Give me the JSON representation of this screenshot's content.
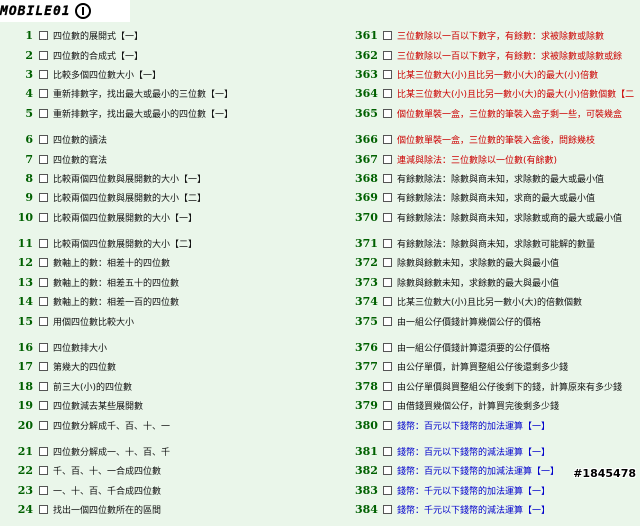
{
  "logo": {
    "text": "MOBILE01"
  },
  "left_groups": [
    [
      {
        "num": "1",
        "label": "四位數的展開式【一】",
        "color": "black"
      },
      {
        "num": "2",
        "label": "四位數的合成式【一】",
        "color": "black"
      },
      {
        "num": "3",
        "label": "比較多個四位數大小【一】",
        "color": "black"
      },
      {
        "num": "4",
        "label": "重新排數字，找出最大或最小的三位數【一】",
        "color": "black"
      },
      {
        "num": "5",
        "label": "重新排數字，找出最大或最小的四位數【一】",
        "color": "black"
      }
    ],
    [
      {
        "num": "6",
        "label": "四位數的讀法",
        "color": "black"
      },
      {
        "num": "7",
        "label": "四位數的寫法",
        "color": "black"
      },
      {
        "num": "8",
        "label": "比較兩個四位數與展開數的大小【一】",
        "color": "black"
      },
      {
        "num": "9",
        "label": "比較兩個四位數與展開數的大小【二】",
        "color": "black"
      },
      {
        "num": "10",
        "label": "比較兩個四位數展開數的大小【一】",
        "color": "black"
      }
    ],
    [
      {
        "num": "11",
        "label": "比較兩個四位數展開數的大小【二】",
        "color": "black"
      },
      {
        "num": "12",
        "label": "數軸上的數：相差十的四位數",
        "color": "black"
      },
      {
        "num": "13",
        "label": "數軸上的數：相差五十的四位數",
        "color": "black"
      },
      {
        "num": "14",
        "label": "數軸上的數：相差一百的四位數",
        "color": "black"
      },
      {
        "num": "15",
        "label": "用個四位數比較大小",
        "color": "black"
      }
    ],
    [
      {
        "num": "16",
        "label": "四位數排大小",
        "color": "black"
      },
      {
        "num": "17",
        "label": "第幾大的四位數",
        "color": "black"
      },
      {
        "num": "18",
        "label": "前三大(小)的四位數",
        "color": "black"
      },
      {
        "num": "19",
        "label": "四位數減去某些展開數",
        "color": "black"
      },
      {
        "num": "20",
        "label": "四位數分解成千、百、十、一",
        "color": "black"
      }
    ],
    [
      {
        "num": "21",
        "label": "四位數分解成一、十、百、千",
        "color": "black"
      },
      {
        "num": "22",
        "label": "千、百、十、一合成四位數",
        "color": "black"
      },
      {
        "num": "23",
        "label": "一、十、百、千合成四位數",
        "color": "black"
      },
      {
        "num": "24",
        "label": "找出一個四位數所在的區間",
        "color": "black"
      }
    ]
  ],
  "right_groups": [
    [
      {
        "num": "361",
        "label": "三位數除以一百以下數字，有餘數：求被除數或除數",
        "color": "red"
      },
      {
        "num": "362",
        "label": "三位數除以一百以下數字，有餘數：求被除數或除數或餘",
        "color": "red"
      },
      {
        "num": "363",
        "label": "比某三位數大(小)且比另一數小(大)的最大(小)倍數",
        "color": "red"
      },
      {
        "num": "364",
        "label": "比某三位數大(小)且比另一數小(大)的最大(小)倍數個數【二",
        "color": "red"
      },
      {
        "num": "365",
        "label": "個位數單裝一盒，三位數的筆裝入盒子剩一些，可裝幾盒",
        "color": "red"
      }
    ],
    [
      {
        "num": "366",
        "label": "個位數單裝一盒，三位數的筆裝入盒後，問餘幾枝",
        "color": "red"
      },
      {
        "num": "367",
        "label": "連減與除法：三位數除以一位數(有餘數)",
        "color": "red"
      },
      {
        "num": "368",
        "label": "有餘數除法：除數與商未知，求除數的最大或最小值",
        "color": "black"
      },
      {
        "num": "369",
        "label": "有餘數除法：除數與商未知，求商的最大或最小值",
        "color": "black"
      },
      {
        "num": "370",
        "label": "有餘數除法：除數與商未知，求除數或商的最大或最小值",
        "color": "black"
      }
    ],
    [
      {
        "num": "371",
        "label": "有餘數除法：除數與商未知，求除數可能解的數量",
        "color": "black"
      },
      {
        "num": "372",
        "label": "除數與餘數未知，求除數的最大與最小值",
        "color": "black"
      },
      {
        "num": "373",
        "label": "除數與餘數未知，求餘數的最大與最小值",
        "color": "black"
      },
      {
        "num": "374",
        "label": "比某三位數大(小)且比另一數小(大)的倍數個數",
        "color": "black"
      },
      {
        "num": "375",
        "label": "由一組公仔價錢計算幾個公仔的價格",
        "color": "black"
      }
    ],
    [
      {
        "num": "376",
        "label": "由一組公仔價錢計算還須要的公仔價格",
        "color": "black"
      },
      {
        "num": "377",
        "label": "由公仔單價，計算買整組公仔後還剩多少錢",
        "color": "black"
      },
      {
        "num": "378",
        "label": "由公仔單價與買整組公仔後剩下的錢，計算原來有多少錢",
        "color": "black"
      },
      {
        "num": "379",
        "label": "由借錢買幾個公仔，計算買完後剩多少錢",
        "color": "black"
      },
      {
        "num": "380",
        "label": "錢幣：百元以下錢幣的加法運算【一】",
        "color": "blue"
      }
    ],
    [
      {
        "num": "381",
        "label": "錢幣：百元以下錢幣的減法運算【一】",
        "color": "blue"
      },
      {
        "num": "382",
        "label": "錢幣：百元以下錢幣的加減法運算【一】",
        "color": "blue"
      },
      {
        "num": "383",
        "label": "錢幣：千元以下錢幣的加法運算【一】",
        "color": "blue"
      },
      {
        "num": "384",
        "label": "錢幣：千元以下錢幣的減法運算【一】",
        "color": "blue"
      }
    ]
  ],
  "watermark": "#1845478"
}
